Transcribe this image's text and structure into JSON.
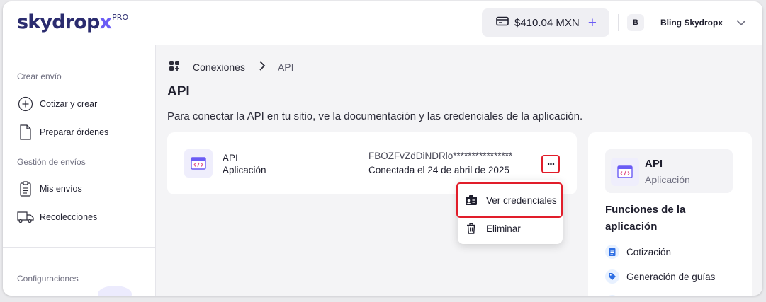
{
  "header": {
    "logo_main": "skydrop",
    "logo_x": "x",
    "logo_badge": "PRO",
    "balance": "$410.04 MXN",
    "avatar_initial": "B",
    "username": "Bling Skydropx"
  },
  "sidebar": {
    "section_create": "Crear envío",
    "item_quote": "Cotizar y crear",
    "item_orders": "Preparar órdenes",
    "section_manage": "Gestión de envíos",
    "item_shipments": "Mis envíos",
    "item_pickups": "Recolecciones",
    "section_config": "Configuraciones"
  },
  "breadcrumb": {
    "parent": "Conexiones",
    "current": "API"
  },
  "page": {
    "title": "API",
    "description": "Para conectar la API en tu sitio, ve la documentación y las credenciales de la aplicación."
  },
  "connection": {
    "name": "API",
    "type": "Aplicación",
    "key": "FBOZFvZdDiNDRlo****************",
    "status": "Conectada el 24 de abril de 2025",
    "more_label": "..."
  },
  "menu": {
    "view_credentials": "Ver credenciales",
    "delete": "Eliminar"
  },
  "panel": {
    "name": "API",
    "type": "Aplicación",
    "functions_title": "Funciones de la aplicación",
    "features": [
      "Cotización",
      "Generación de guías"
    ]
  },
  "colors": {
    "accent": "#6b5cf5",
    "brand_dark": "#2b2c6f",
    "highlight_red": "#e11d2a",
    "feature_blue": "#2f6fe4"
  }
}
